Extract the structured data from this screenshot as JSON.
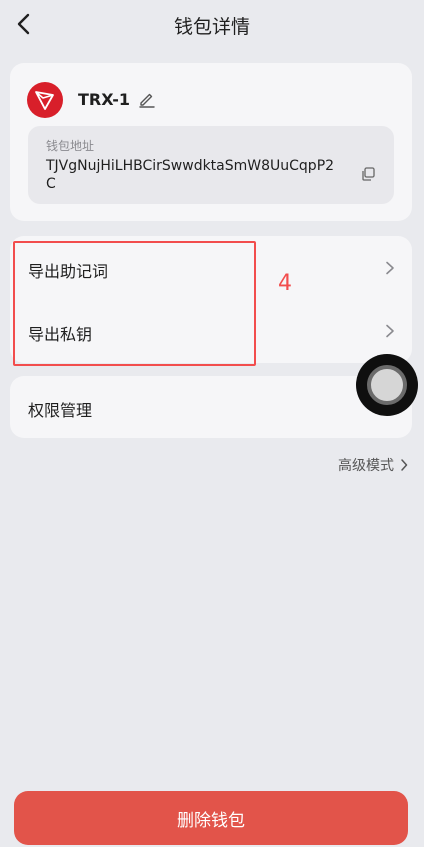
{
  "header": {
    "title": "钱包详情"
  },
  "wallet": {
    "name": "TRX-1",
    "address_label": "钱包地址",
    "address": "TJVgNujHiLHBCirSwwdktaSmW8UuCqpP2C"
  },
  "export": {
    "mnemonic": "导出助记词",
    "private_key": "导出私钥",
    "annotation": "4"
  },
  "permission": {
    "label": "权限管理"
  },
  "advanced": {
    "label": "高级模式"
  },
  "delete": {
    "label": "删除钱包"
  },
  "colors": {
    "background": "#e9eaee",
    "card": "#f6f6f8",
    "tron_red": "#d81f2a",
    "delete_button": "#e2544a",
    "annotation": "#f24d4d"
  },
  "icons": {
    "back": "chevron-left-icon",
    "edit": "pencil-icon",
    "copy": "copy-icon",
    "chevron": "chevron-right-icon",
    "logo": "tron-logo-icon"
  }
}
